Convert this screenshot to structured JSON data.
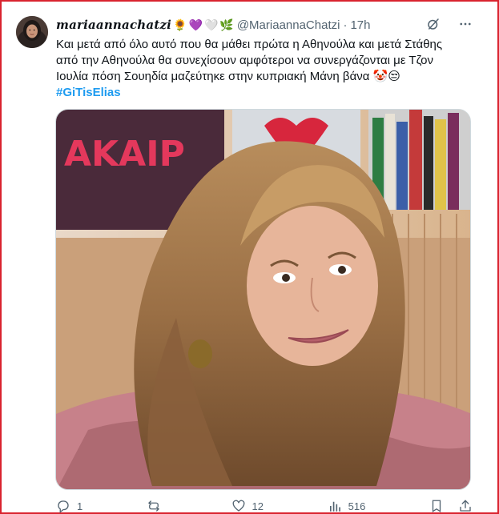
{
  "tweet": {
    "display_name": "mariaannachatzi",
    "name_emojis": [
      "🌻",
      "💜",
      "🤍",
      "🌿"
    ],
    "handle": "@MariaannaChatzi",
    "separator": "·",
    "time": "17h",
    "text_lines": [
      "Και μετά από όλο αυτό που θα μάθει πρώτα η Αθηνούλα και μετά Στάθης",
      "από την Αθηνούλα θα συνεχίσουν αμφότεροι να συνεργάζονται με Τζον",
      "Ιουλία πόση Σουηδία μαζεύτηκε στην κυπριακή Μάνη βάνα 🤡😒"
    ],
    "hashtag": "#GiTisElias"
  },
  "actions": {
    "reply_count": "1",
    "retweet_count": "",
    "like_count": "12",
    "views_count": "516"
  },
  "icons": {
    "grok": "slash-circle-icon",
    "more": "more-icon",
    "reply": "reply-icon",
    "retweet": "retweet-icon",
    "like": "heart-icon",
    "views": "views-icon",
    "bookmark": "bookmark-icon",
    "share": "share-icon"
  },
  "colors": {
    "hashtag": "#1d9bf0",
    "secondary_text": "#536471",
    "frame_border": "#d9232e"
  }
}
